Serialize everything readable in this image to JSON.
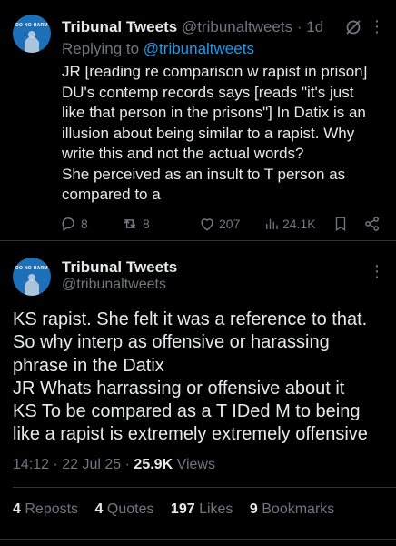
{
  "reply_tweet": {
    "author_name": "Tribunal Tweets",
    "author_handle": "@tribunaltweets",
    "dot": "·",
    "time_ago": "1d",
    "replying_to_label": "Replying to",
    "replying_to_handle": "@tribunaltweets",
    "lines": [
      "JR  [reading re comparison w rapist in prison]",
      "DU's contemp records says [reads \"it's just",
      "like that person in the  prisons\"] In Datix is an",
      "illusion about being similar to a rapist. Why",
      "write this and not the actual words?",
      "She perceived as an insult to T person as",
      "compared to a"
    ],
    "actions": {
      "replies": "8",
      "reposts": "8",
      "likes": "207",
      "views": "24.1K"
    },
    "avatar_text": "DO NO HARM"
  },
  "main_tweet": {
    "author_name": "Tribunal Tweets",
    "author_handle": "@tribunaltweets",
    "lines": [
      "KS  rapist. She felt it was a reference to that.",
      "So why interp as offensive or harassing",
      "phrase in the Datix",
      "JR  Whats harrassing or offensive about it",
      "KS  To be compared as a T IDed M to being",
      "like a rapist is extremely extremely offensive"
    ],
    "timestamp": "14:12 · 22 Jul 25 ·",
    "views_count": "25.9K",
    "views_label": "Views",
    "stats": {
      "reposts_count": "4",
      "reposts_label": "Reposts",
      "quotes_count": "4",
      "quotes_label": "Quotes",
      "likes_count": "197",
      "likes_label": "Likes",
      "bookmarks_count": "9",
      "bookmarks_label": "Bookmarks"
    },
    "avatar_text": "DO NO HARM"
  },
  "colors": {
    "background": "#000000",
    "text": "#e7e9ea",
    "muted": "#71767b",
    "link": "#1d9bf0",
    "avatar": "#1d6fb8",
    "divider": "#2f3336"
  },
  "icons": [
    "reply-icon",
    "repost-icon",
    "like-icon",
    "views-icon",
    "bookmark-icon",
    "share-icon",
    "grok-icon",
    "more-icon"
  ]
}
